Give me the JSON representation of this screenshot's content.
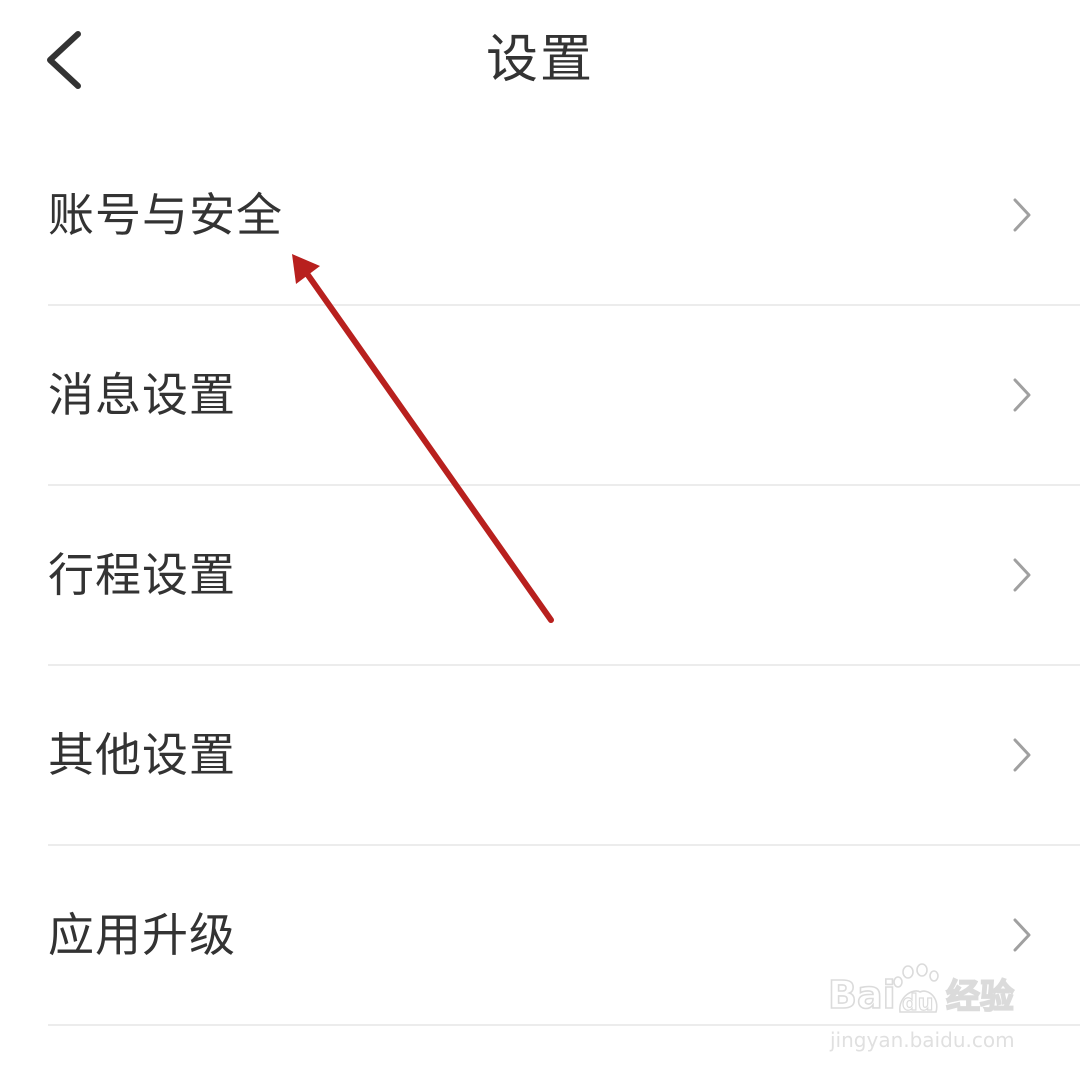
{
  "header": {
    "title": "设置",
    "back_icon": "chevron-left-icon"
  },
  "menu": {
    "items": [
      {
        "label": "账号与安全",
        "icon": "chevron-right-icon"
      },
      {
        "label": "消息设置",
        "icon": "chevron-right-icon"
      },
      {
        "label": "行程设置",
        "icon": "chevron-right-icon"
      },
      {
        "label": "其他设置",
        "icon": "chevron-right-icon"
      },
      {
        "label": "应用升级",
        "icon": "chevron-right-icon"
      }
    ]
  },
  "annotation": {
    "arrow_color": "#b8201e",
    "target": "账号与安全"
  },
  "watermark": {
    "logo_text": "Bai du 经验",
    "url": "jingyan.baidu.com"
  },
  "colors": {
    "text": "#333333",
    "chevron": "#a0a0a0",
    "divider": "#ececec",
    "background": "#ffffff"
  }
}
